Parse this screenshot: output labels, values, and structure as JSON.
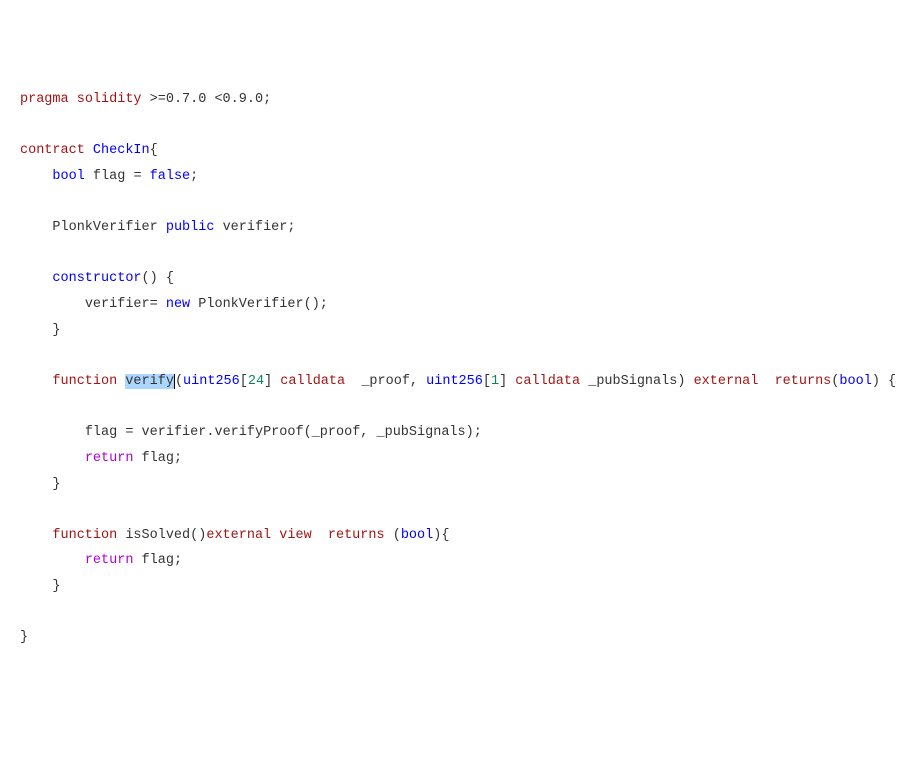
{
  "code": {
    "l1": {
      "pragma": "pragma",
      "solidity": "solidity",
      "ver": ">=0.7.0 <0.9.0",
      "semi": ";"
    },
    "l3": {
      "contract": "contract",
      "name": "CheckIn",
      "brace": "{"
    },
    "l4": {
      "bool": "bool",
      "flag": "flag",
      "eq": "=",
      "false": "false",
      "semi": ";"
    },
    "l6": {
      "type": "PlonkVerifier",
      "public": "public",
      "id": "verifier",
      "semi": ";"
    },
    "l8": {
      "ctor": "constructor",
      "paren": "()",
      "brace": "{"
    },
    "l9": {
      "id": "verifier",
      "eq": "=",
      "new": "new",
      "type": "PlonkVerifier",
      "paren": "()",
      "semi": ";"
    },
    "l10": {
      "brace": "}"
    },
    "l12": {
      "function": "function",
      "name": "verify",
      "p1a": "(",
      "t1": "uint256",
      "lb1": "[",
      "n1": "24",
      "rb1": "]",
      "calldata1": "calldata",
      "arg1": "_proof",
      "comma": ",",
      "t2": "uint256",
      "lb2": "[",
      "n2": "1",
      "rb2": "]",
      "calldata2": "calldata",
      "arg2": "_pubSignals",
      "p1b": ")",
      "external": "external",
      "returns": "returns",
      "rpa": "(",
      "rbool": "bool",
      "rpb": ")",
      "brace": "{"
    },
    "l14": {
      "flag": "flag",
      "eq": "=",
      "obj": "verifier",
      "dot": ".",
      "fn": "verifyProof",
      "args": "(_proof, _pubSignals)",
      "semi": ";"
    },
    "l15": {
      "return": "return",
      "flag": "flag",
      "semi": ";"
    },
    "l16": {
      "brace": "}"
    },
    "l18": {
      "function": "function",
      "name": "isSolved",
      "paren": "()",
      "external": "external",
      "view": "view",
      "returns": "returns",
      "rpa": "(",
      "rbool": "bool",
      "rpb": ")",
      "brace": "{"
    },
    "l19": {
      "return": "return",
      "flag": "flag",
      "semi": ";"
    },
    "l20": {
      "brace": "}"
    },
    "l22": {
      "brace": "}"
    }
  }
}
